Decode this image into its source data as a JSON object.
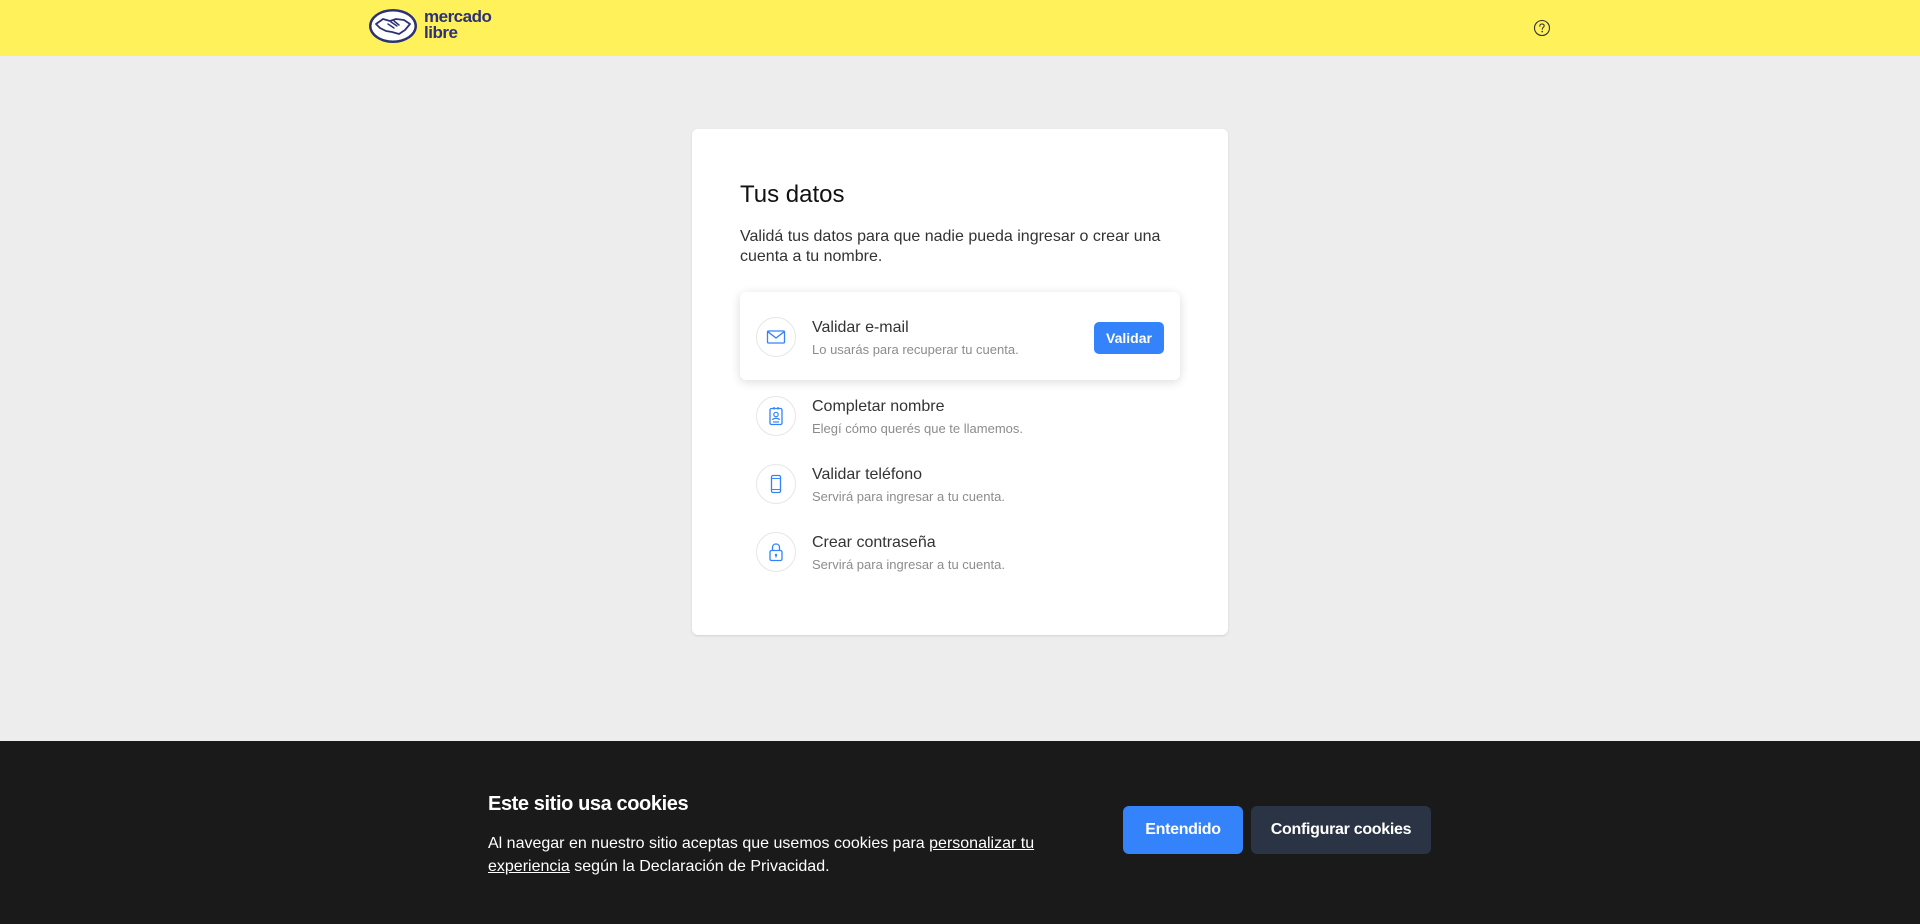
{
  "header": {
    "logo_line1": "mercado",
    "logo_line2": "libre",
    "help_icon": "help-circle-icon",
    "background": "#fff159"
  },
  "card": {
    "title": "Tus datos",
    "description": "Validá tus datos para que nadie pueda ingresar o crear una cuenta a tu nombre.",
    "items": [
      {
        "icon": "envelope-icon",
        "title": "Validar e-mail",
        "subtitle": "Lo usarás para recuperar tu cuenta.",
        "button": "Validar"
      },
      {
        "icon": "id-badge-icon",
        "title": "Completar nombre",
        "subtitle": "Elegí cómo querés que te llamemos."
      },
      {
        "icon": "phone-icon",
        "title": "Validar teléfono",
        "subtitle": "Servirá para ingresar a tu cuenta."
      },
      {
        "icon": "lock-icon",
        "title": "Crear contraseña",
        "subtitle": "Servirá para ingresar a tu cuenta."
      }
    ]
  },
  "cookies": {
    "title": "Este sitio usa cookies",
    "text_before": "Al navegar en nuestro sitio aceptas que usemos cookies para ",
    "link_text": "personalizar tu experiencia",
    "text_after": " según la Declaración de Privacidad.",
    "accept_button": "Entendido",
    "config_button": "Configurar cookies"
  },
  "colors": {
    "accent": "#3483fa",
    "brand_yellow": "#fff159",
    "brand_navy": "#2d3277",
    "cookie_bg": "#1a1a1a"
  }
}
